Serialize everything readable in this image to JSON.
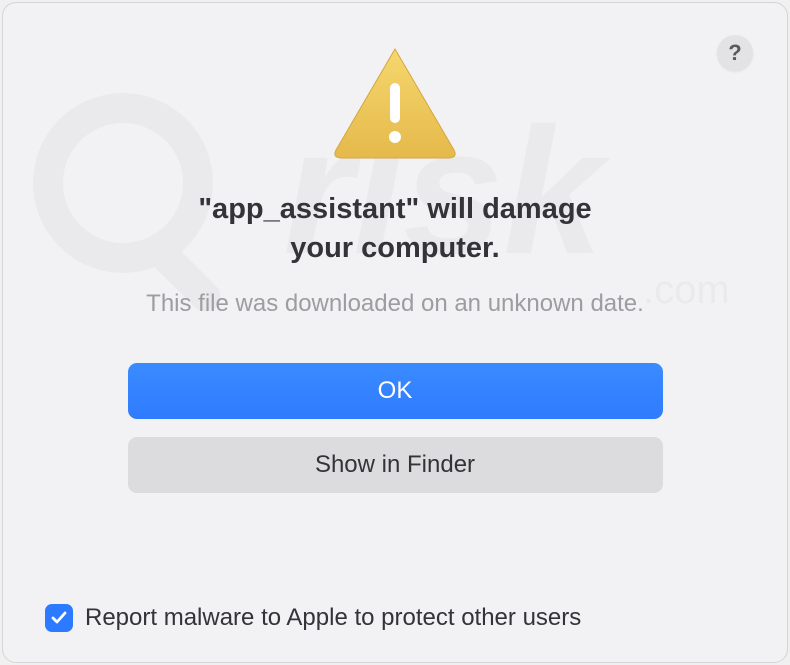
{
  "dialog": {
    "title_line1": "\"app_assistant\" will damage",
    "title_line2": "your computer.",
    "subtitle": "This file was downloaded on an unknown date.",
    "buttons": {
      "primary": "OK",
      "secondary": "Show in Finder"
    },
    "help_label": "?",
    "checkbox": {
      "checked": true,
      "label": "Report malware to Apple to protect other users"
    }
  },
  "icons": {
    "warning": "warning-triangle-icon",
    "help": "help-icon",
    "check": "checkmark-icon"
  },
  "colors": {
    "primary_button": "#2f7bff",
    "secondary_button": "#dcdcde",
    "checkbox": "#2c7aff",
    "background": "#f2f2f4"
  }
}
